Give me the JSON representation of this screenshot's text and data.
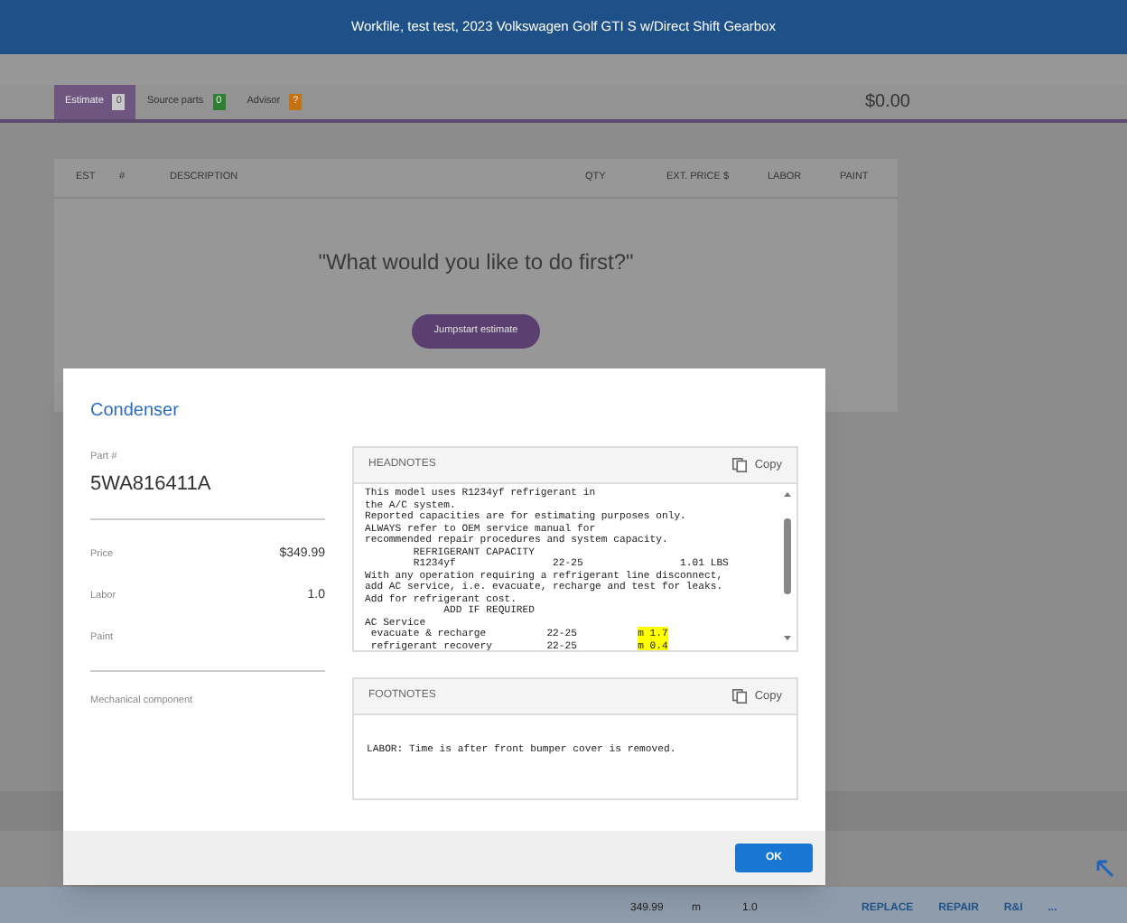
{
  "window": {
    "title": "Workfile, test test, 2023 Volkswagen Golf GTI S w/Direct Shift Gearbox"
  },
  "tabs": [
    {
      "label": "Estimate",
      "count": "0",
      "color": "#c8c8c8",
      "selected": true
    },
    {
      "label": "Source parts",
      "count": "0",
      "color": "#2f7f33",
      "selected": false
    },
    {
      "label": "Advisor",
      "count": "?",
      "color": "#c47212",
      "selected": false
    }
  ],
  "total": "$0.00",
  "table": {
    "columns": [
      "EST",
      "#",
      "DESCRIPTION",
      "QTY",
      "EXT. PRICE $",
      "LABOR",
      "PAINT"
    ]
  },
  "prompt": "\"What would you like to do first?\"",
  "jumpstart_button": "Jumpstart estimate",
  "dialog": {
    "title": "Condenser",
    "part_number_label": "Part #",
    "part_number": "5WA816411A",
    "fields": [
      {
        "label": "Price",
        "value": "$349.99"
      },
      {
        "label": "Labor",
        "value": "1.0"
      },
      {
        "label": "Paint"
      }
    ],
    "category": "Mechanical component",
    "headnotes": {
      "title": "HEADNOTES",
      "copy": "Copy",
      "lines": [
        {
          "text": "This model uses R1234yf refrigerant in"
        },
        {
          "text": "the A/C system."
        },
        {
          "text": "Reported capacities are for estimating purposes only."
        },
        {
          "text": "ALWAYS refer to OEM service manual for"
        },
        {
          "text": "recommended repair procedures and system capacity."
        },
        {
          "text": "        REFRIGERANT CAPACITY"
        },
        {
          "text": "        R1234yf                22-25                1.01 LBS"
        },
        {
          "text": "With any operation requiring a refrigerant line disconnect,"
        },
        {
          "text": "add AC service, i.e. evacuate, recharge and test for leaks."
        },
        {
          "text": "Add for refrigerant cost."
        },
        {
          "text": "             ADD IF REQUIRED"
        },
        {
          "text": "AC Service"
        },
        {
          "text": " evacuate & recharge          22-25          ",
          "highlight": "m 1.7"
        },
        {
          "text": " refrigerant recovery         22-25          ",
          "highlight": "m 0.4"
        }
      ]
    },
    "footnotes": {
      "title": "FOOTNOTES",
      "copy": "Copy",
      "text": "LABOR: Time is after front bumper cover is removed."
    },
    "ok_button": "OK"
  },
  "bottom_row": {
    "price": "349.99",
    "unit": "m",
    "labor": "1.0",
    "actions": [
      "REPLACE",
      "REPAIR",
      "R&I",
      "..."
    ]
  }
}
